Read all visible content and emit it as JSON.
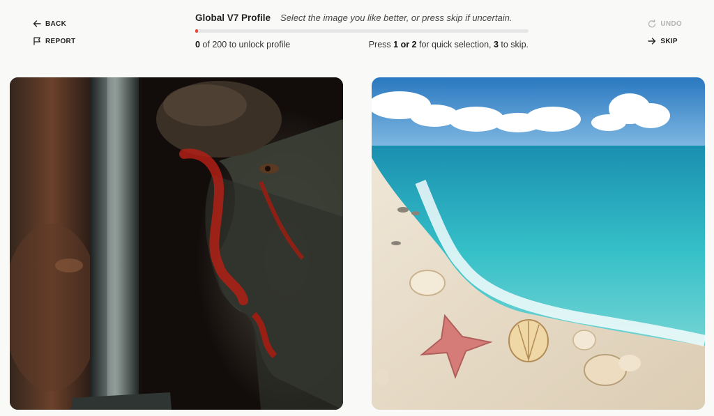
{
  "nav": {
    "back_label": "BACK",
    "report_label": "REPORT",
    "undo_label": "UNDO",
    "skip_label": "SKIP"
  },
  "header": {
    "title": "Global V7 Profile",
    "instruction": "Select the image you like better, or press skip if uncertain."
  },
  "progress": {
    "count": "0",
    "count_suffix": " of 200 to unlock profile",
    "completed": 0,
    "total": 200
  },
  "hint": {
    "prefix": "Press ",
    "keys_select": "1 or 2",
    "middle": " for quick selection, ",
    "key_skip": "3",
    "suffix": " to skip."
  },
  "images": {
    "left": "warrior-portrait-with-sword",
    "right": "tropical-beach-with-starfish-and-shells"
  },
  "colors": {
    "accent": "#e84a3a",
    "background": "#f9f9f7",
    "disabled": "#b4b4b4"
  }
}
